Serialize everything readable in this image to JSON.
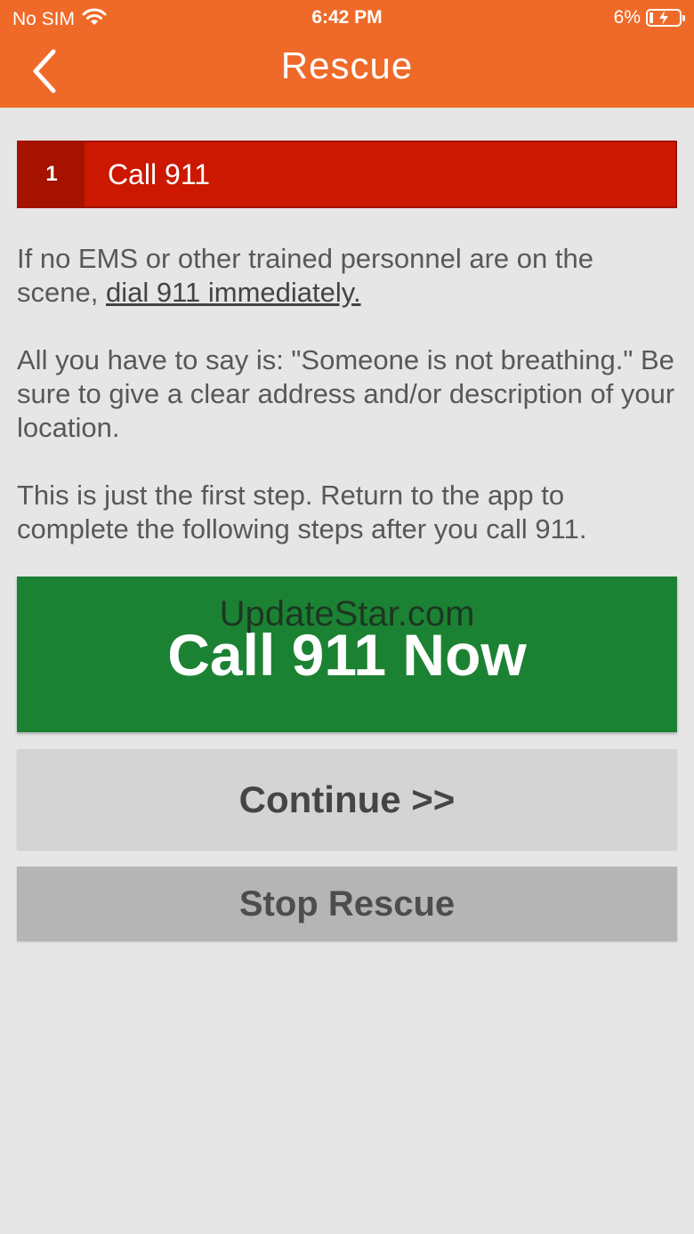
{
  "status_bar": {
    "carrier": "No SIM",
    "time": "6:42 PM",
    "battery": "6%"
  },
  "nav": {
    "title": "Rescue"
  },
  "step": {
    "number": "1",
    "title": "Call 911"
  },
  "instructions": {
    "p1_text": "If no EMS or other trained personnel are on the scene, ",
    "p1_link": "dial 911 immediately.",
    "p2": "All you have to say is: \"Someone is not breathing.\" Be sure to give a clear address and/or description of your location.",
    "p3": "This is just the first step. Return to the app to complete the following steps after you call 911."
  },
  "buttons": {
    "call": "Call 911 Now",
    "continue": "Continue >>",
    "stop": "Stop Rescue"
  },
  "watermark": "UpdateStar.com",
  "colors": {
    "header": "#ef6a28",
    "step_red": "#cc1800",
    "call_green": "#1c8233"
  }
}
